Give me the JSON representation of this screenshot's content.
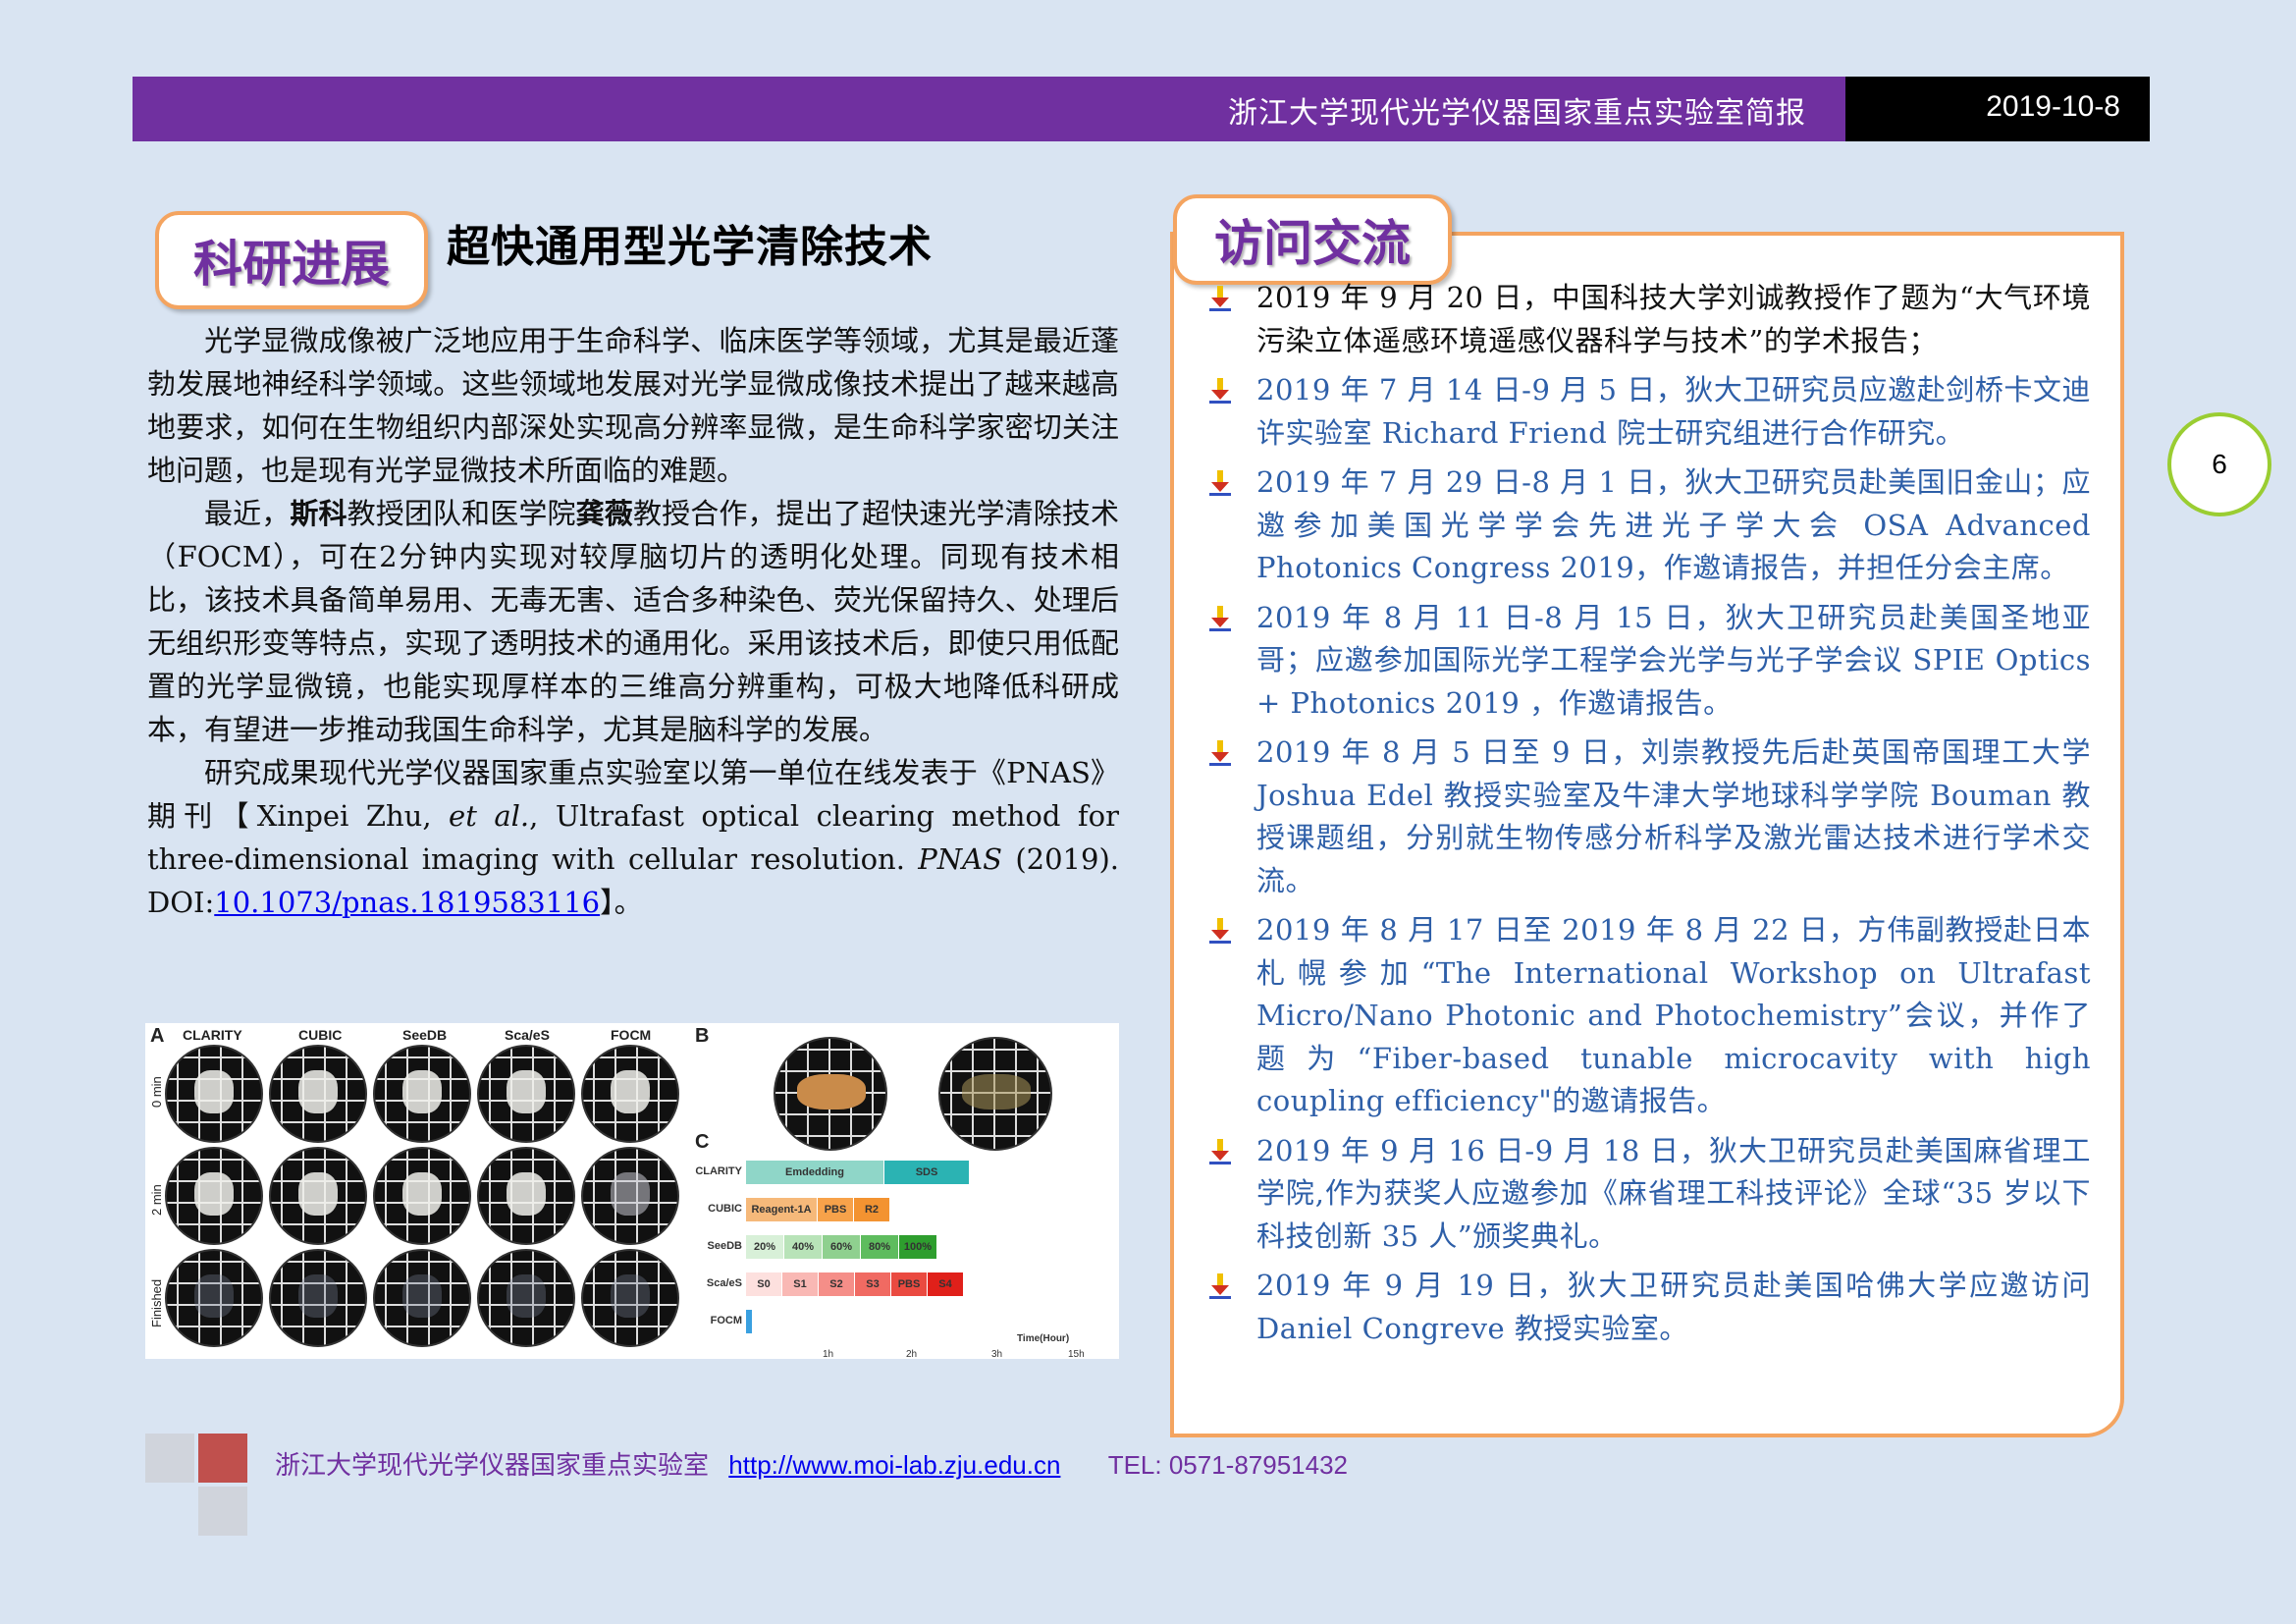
{
  "header": {
    "title": "浙江大学现代光学仪器国家重点实验室简报",
    "date": "2019-10-8"
  },
  "page_number": "6",
  "left": {
    "tab": "科研进展",
    "title": "超快通用型光学清除技术",
    "p1": "光学显微成像被广泛地应用于生命科学、临床医学等领域，尤其是最近蓬勃发展地神经科学领域。这些领域地发展对光学显微成像技术提出了越来越高地要求，如何在生物组织内部深处实现高分辨率显微，是生命科学家密切关注地问题，也是现有光学显微技术所面临的难题。",
    "p2a": "最近，",
    "p2_name1": "斯科",
    "p2b": "教授团队和医学院",
    "p2_name2": "龚薇",
    "p2c": "教授合作，提出了超快速光学清除技术（FOCM），可在2分钟内实现对较厚脑切片的透明化处理。同现有技术相比，该技术具备简单易用、无毒无害、适合多种染色、荧光保留持久、处理后无组织形变等特点，实现了透明技术的通用化。采用该技术后，即使只用低配置的光学显微镜，也能实现厚样本的三维高分辨重构，可极大地降低科研成本，有望进一步推动我国生命科学，尤其是脑科学的发展。",
    "p3a": "研究成果现代光学仪器国家重点实验室以第一单位在线发表于《PNAS》期刊【Xinpei Zhu, ",
    "p3_etal": "et al.",
    "p3b": ", Ultrafast optical clearing method for three-dimensional imaging with cellular resolution. ",
    "p3_journal": "PNAS",
    "p3c": " (2019). DOI:",
    "p3_doi": "10.1073/pnas.1819583116",
    "p3d": "】。"
  },
  "figure": {
    "panel_a": "A",
    "panel_b": "B",
    "panel_c": "C",
    "columns": [
      "CLARITY",
      "CUBIC",
      "SeeDB",
      "Sca/eS",
      "FOCM"
    ],
    "rows": [
      "0 min",
      "2 min",
      "Finished"
    ],
    "chart_data": {
      "type": "bar",
      "categories": [
        "CLARITY",
        "CUBIC",
        "SeeDB",
        "Sca/eS",
        "FOCM"
      ],
      "segments": [
        [
          {
            "label": "Emdedding",
            "color": "#8fd6c8"
          },
          {
            "label": "SDS",
            "color": "#2bb3b3"
          }
        ],
        [
          {
            "label": "Reagent-1A",
            "color": "#f6b97a"
          },
          {
            "label": "PBS",
            "color": "#f7a24a"
          },
          {
            "label": "R2",
            "color": "#f39331"
          }
        ],
        [
          {
            "label": "20%",
            "color": "#d8f0d8"
          },
          {
            "label": "40%",
            "color": "#b8e3b8"
          },
          {
            "label": "60%",
            "color": "#8fd08f"
          },
          {
            "label": "80%",
            "color": "#5ebc5e"
          },
          {
            "label": "100%",
            "color": "#2e9e2e"
          }
        ],
        [
          {
            "label": "S0",
            "color": "#fde0de"
          },
          {
            "label": "S1",
            "color": "#f9b8b4"
          },
          {
            "label": "S2",
            "color": "#f58e88"
          },
          {
            "label": "S3",
            "color": "#f06a62"
          },
          {
            "label": "PBS",
            "color": "#ea4a40"
          },
          {
            "label": "S4",
            "color": "#e0201a"
          }
        ],
        [
          {
            "label": "",
            "color": "#3aa0e0"
          }
        ]
      ],
      "x_ticks": [
        "1h",
        "2h",
        "3h",
        "15h"
      ],
      "xlabel": "Time(Hour)"
    }
  },
  "right": {
    "tab": "访问交流",
    "items": [
      "2019 年 9 月 20 日，中国科技大学刘诚教授作了题为“大气环境污染立体遥感环境遥感仪器科学与技术”的学术报告；",
      "2019 年 7 月 14 日-9 月 5 日，狄大卫研究员应邀赴剑桥卡文迪许实验室 Richard Friend 院士研究组进行合作研究。",
      "2019 年 7 月 29 日-8 月 1 日，狄大卫研究员赴美国旧金山；应邀参加美国光学学会先进光子学大会 OSA Advanced Photonics Congress 2019，作邀请报告，并担任分会主席。",
      "2019 年 8 月 11 日-8 月 15 日，狄大卫研究员赴美国圣地亚哥；应邀参加国际光学工程学会光学与光子学会议 SPIE Optics + Photonics 2019 ，作邀请报告。",
      "2019 年 8 月 5 日至 9 日，刘崇教授先后赴英国帝国理工大学 Joshua Edel 教授实验室及牛津大学地球科学学院 Bouman 教授课题组，分别就生物传感分析科学及激光雷达技术进行学术交流。",
      "2019 年 8 月 17 日至 2019 年 8 月 22 日，方伟副教授赴日本札幌参加“The International Workshop on Ultrafast Micro/Nano Photonic and Photochemistry”会议，并作了题为“Fiber-based tunable microcavity with high coupling efficiency\"的邀请报告。",
      "2019 年 9 月 16 日-9 月 18 日，狄大卫研究员赴美国麻省理工学院,作为获奖人应邀参加《麻省理工科技评论》全球“35 岁以下科技创新 35 人”颁奖典礼。",
      "2019 年 9 月 19 日，狄大卫研究员赴美国哈佛大学应邀访问 Daniel Congreve 教授实验室。"
    ]
  },
  "footer": {
    "org": "浙江大学现代光学仪器国家重点实验室",
    "url": "http://www.moi-lab.zju.edu.cn",
    "tel": "TEL: 0571-87951432"
  },
  "colors": {
    "purple": "#7030a0",
    "orange_border": "#f4a460",
    "blue_text": "#2e5fa8",
    "green_ring": "#9acd32"
  }
}
